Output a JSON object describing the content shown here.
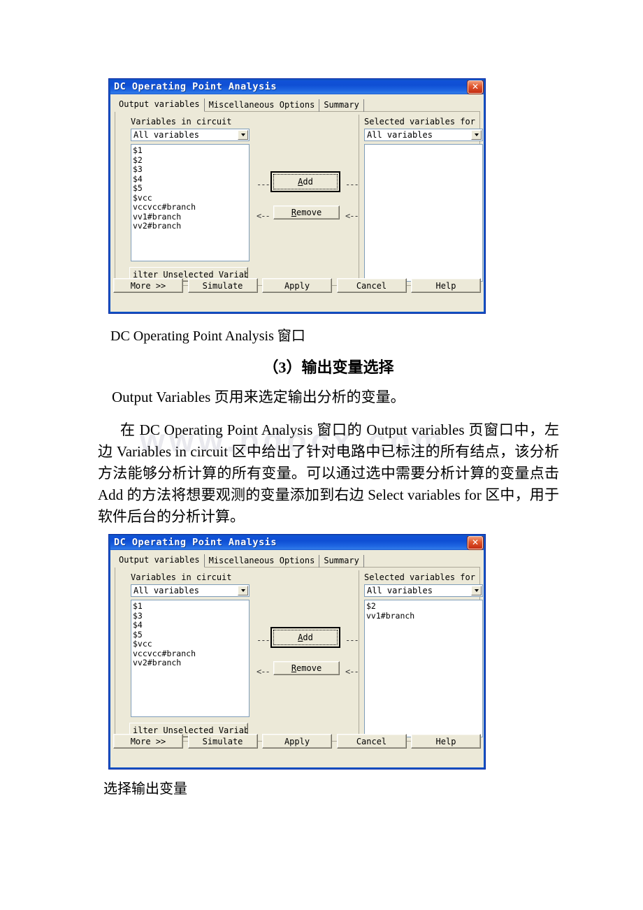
{
  "document": {
    "watermark": "www.bdocx.com",
    "caption1": "DC Operating Point Analysis 窗口",
    "heading3": "（3）输出变量选择",
    "intro": "Output Variables 页用来选定输出分析的变量。",
    "paragraph": "在 DC Operating Point Analysis 窗口的 Output variables 页窗口中，左边 Variables in circuit 区中给出了针对电路中已标注的所有结点，该分析方法能够分析计算的所有变量。可以通过选中需要分析计算的变量点击 Add 的方法将想要观测的变量添加到右边 Select variables for 区中，用于软件后台的分析计算。",
    "caption2": "选择输出变量"
  },
  "dialog1": {
    "title": "DC Operating Point Analysis",
    "close_label": "✕",
    "tabs": [
      {
        "label": "Output variables",
        "active": true
      },
      {
        "label": "Miscellaneous Options",
        "active": false
      },
      {
        "label": "Summary",
        "active": false
      }
    ],
    "left": {
      "label": "Variables in circuit",
      "filter_value": "All variables",
      "items": [
        "$1",
        "$2",
        "$3",
        "$4",
        "$5",
        "$vcc",
        "vccvcc#branch",
        "vv1#branch",
        "vv2#branch"
      ],
      "filter_button": "ilter Unselected Variables"
    },
    "right": {
      "label": "Selected variables for",
      "filter_value": "All variables",
      "items": []
    },
    "middle": {
      "add_label": "Add",
      "add_mnemonic": "A",
      "remove_label": "Remove",
      "remove_mnemonic": "R",
      "add_left_mark": "---",
      "add_right_mark": "---",
      "remove_left_mark": "<--",
      "remove_right_mark": "<--"
    },
    "buttons": [
      "More >>",
      "Simulate",
      "Apply",
      "Cancel",
      "Help"
    ]
  },
  "dialog2": {
    "title": "DC Operating Point Analysis",
    "close_label": "✕",
    "tabs": [
      {
        "label": "Output variables",
        "active": true
      },
      {
        "label": "Miscellaneous Options",
        "active": false
      },
      {
        "label": "Summary",
        "active": false
      }
    ],
    "left": {
      "label": "Variables in circuit",
      "filter_value": "All variables",
      "items": [
        "$1",
        "$3",
        "$4",
        "$5",
        "$vcc",
        "vccvcc#branch",
        "vv2#branch"
      ],
      "filter_button": "ilter Unselected Variables"
    },
    "right": {
      "label": "Selected variables for",
      "filter_value": "All variables",
      "items": [
        "$2",
        "vv1#branch"
      ]
    },
    "middle": {
      "add_label": "Add",
      "add_mnemonic": "A",
      "remove_label": "Remove",
      "remove_mnemonic": "R",
      "add_left_mark": "---",
      "add_right_mark": "---",
      "remove_left_mark": "<--",
      "remove_right_mark": "<--"
    },
    "buttons": [
      "More >>",
      "Simulate",
      "Apply",
      "Cancel",
      "Help"
    ]
  },
  "colors": {
    "titlebar_blue": "#1152d8",
    "dialog_face": "#ece9d8",
    "close_red": "#c32c12",
    "border_blue": "#1053c4"
  }
}
